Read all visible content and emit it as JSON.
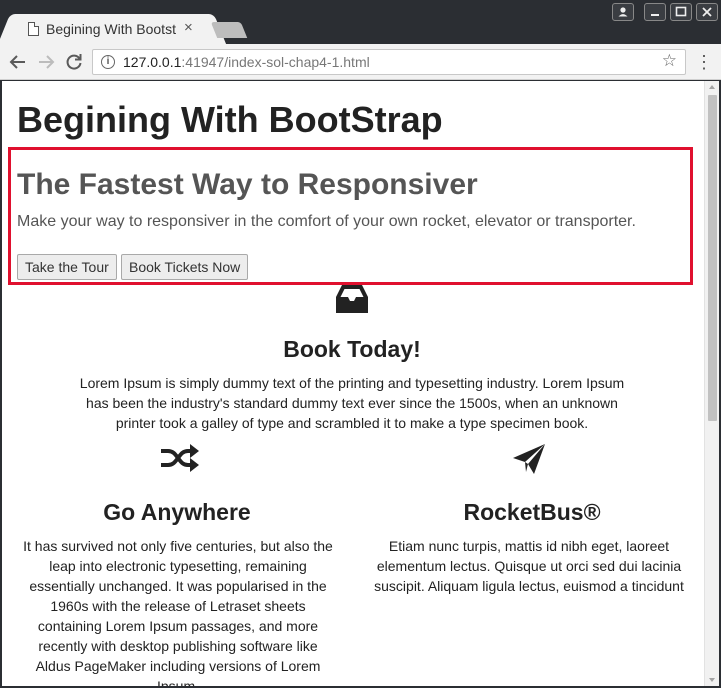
{
  "browser": {
    "tab_title": "Begining With Bootstrap",
    "tab_close": "×",
    "url_host": "127.0.0.1",
    "url_rest": ":41947/index-sol-chap4-1.html"
  },
  "page": {
    "heading": "Begining With BootStrap",
    "jumbotron": {
      "title": "The Fastest Way to Responsiver",
      "lead": "Make your way to responsiver in the comfort of your own rocket, elevator or transporter.",
      "btn_tour": "Take the Tour",
      "btn_tickets": "Book Tickets Now"
    },
    "features": [
      {
        "icon": "inbox-icon",
        "title": "Book Today!",
        "text": "Lorem Ipsum is simply dummy text of the printing and typesetting industry. Lorem Ipsum has been the industry's standard dummy text ever since the 1500s, when an unknown printer took a galley of type and scrambled it to make a type specimen book."
      },
      {
        "icon": "shuffle-icon",
        "title": "Go Anywhere",
        "text": "It has survived not only five centuries, but also the leap into electronic typesetting, remaining essentially unchanged. It was popularised in the 1960s with the release of Letraset sheets containing Lorem Ipsum passages, and more recently with desktop publishing software like Aldus PageMaker including versions of Lorem Ipsum."
      },
      {
        "icon": "paper-plane-icon",
        "title": "RocketBus®",
        "text": "Etiam nunc turpis, mattis id nibh eget, laoreet elementum lectus. Quisque ut orci sed dui lacinia suscipit. Aliquam ligula lectus, euismod a tincidunt"
      }
    ]
  },
  "colors": {
    "highlight_border": "#e0102e",
    "chrome_dark": "#2b2e33"
  }
}
